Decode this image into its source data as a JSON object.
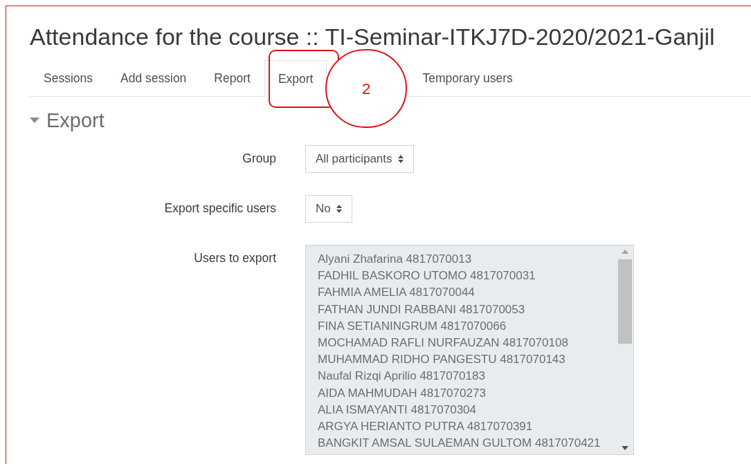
{
  "title": "Attendance for the course :: TI-Seminar-ITKJ7D-2020/2021-Ganjil",
  "tabs": [
    {
      "label": "Sessions",
      "selected": false
    },
    {
      "label": "Add session",
      "selected": false
    },
    {
      "label": "Report",
      "selected": false
    },
    {
      "label": "Export",
      "selected": true
    },
    {
      "label": "Temporary users",
      "selected": false
    }
  ],
  "section": {
    "title": "Export",
    "expanded": true
  },
  "fields": [
    {
      "kind": "select",
      "label": "Group",
      "value": "All participants"
    },
    {
      "kind": "select",
      "label": "Export specific users",
      "value": "No"
    },
    {
      "kind": "list",
      "label": "Users to export",
      "disabled": true,
      "items": [
        "Alyani Zhafarina 4817070013",
        "FADHIL BASKORO UTOMO 4817070031",
        "FAHMIA AMELIA 4817070044",
        "FATHAN JUNDI RABBANI 4817070053",
        "FINA SETIANINGRUM 4817070066",
        "MOCHAMAD RAFLI NURFAUZAN 4817070108",
        "MUHAMMAD RIDHO PANGESTU 4817070143",
        "Naufal Rizqi Aprilio 4817070183",
        "AIDA MAHMUDAH 4817070273",
        "ALIA ISMAYANTI 4817070304",
        "ARGYA HERIANTO PUTRA 4817070391",
        "BANGKIT AMSAL SULAEMAN GULTOM 4817070421"
      ]
    }
  ],
  "annotation": {
    "label": "2"
  }
}
